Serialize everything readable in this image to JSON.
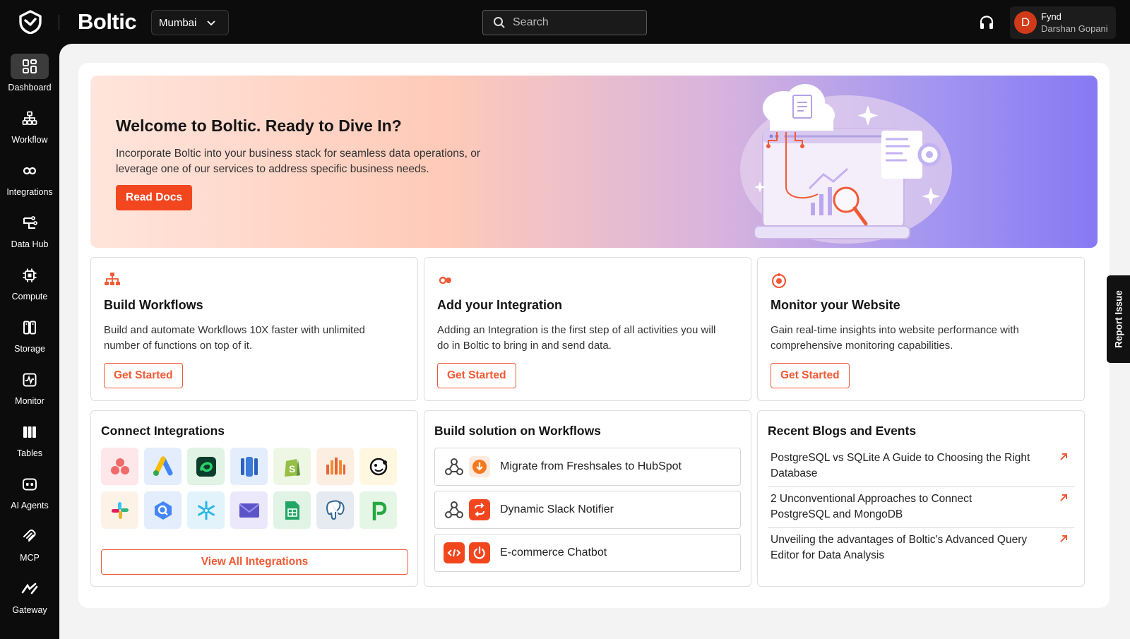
{
  "app": {
    "brand": "Boltic",
    "region": "Mumbai",
    "search_placeholder": "Search",
    "user_org": "Fynd",
    "user_name": "Darshan Gopani",
    "avatar_initial": "D",
    "report_issue": "Report Issue",
    "accent": "#f2461f"
  },
  "sidebar": {
    "items": [
      {
        "label": "Dashboard",
        "icon": "dashboard-icon",
        "active": true
      },
      {
        "label": "Workflow",
        "icon": "workflow-icon"
      },
      {
        "label": "Integrations",
        "icon": "integrations-icon"
      },
      {
        "label": "Data Hub",
        "icon": "data-hub-icon"
      },
      {
        "label": "Compute",
        "icon": "compute-icon"
      },
      {
        "label": "Storage",
        "icon": "storage-icon"
      },
      {
        "label": "Monitor",
        "icon": "monitor-icon"
      },
      {
        "label": "Tables",
        "icon": "tables-icon"
      },
      {
        "label": "AI Agents",
        "icon": "ai-agents-icon"
      },
      {
        "label": "MCP",
        "icon": "mcp-icon"
      },
      {
        "label": "Gateway",
        "icon": "gateway-icon"
      }
    ]
  },
  "hero": {
    "title": "Welcome to Boltic. Ready to Dive In?",
    "description": "Incorporate Boltic into your business stack for seamless data operations, or leverage one of our services to address specific business needs.",
    "button": "Read Docs"
  },
  "cards": [
    {
      "title": "Build Workflows",
      "description": "Build and automate Workflows 10X faster with unlimited number of functions on top of it.",
      "button": "Get Started",
      "icon": "workflow-icon"
    },
    {
      "title": "Add your Integration",
      "description": "Adding an Integration is the first step of all activities you will do in Boltic to bring in and send data.",
      "button": "Get Started",
      "icon": "integration-icon"
    },
    {
      "title": "Monitor your Website",
      "description": "Gain real-time insights into website performance with comprehensive monitoring capabilities.",
      "button": "Get Started",
      "icon": "monitor-icon"
    }
  ],
  "integrations": {
    "title": "Connect Integrations",
    "button": "View All Integrations",
    "icons": [
      "asana-icon",
      "google-ads-icon",
      "zoho-icon",
      "azure-db-icon",
      "shopify-icon",
      "aws-redshift-icon",
      "mailchimp-icon",
      "slack-icon",
      "bigquery-icon",
      "snowflake-icon",
      "email-icon",
      "google-sheets-icon",
      "postgresql-icon",
      "pipedrive-icon"
    ]
  },
  "workflows": {
    "title": "Build solution on Workflows",
    "items": [
      {
        "label": "Migrate from Freshsales to HubSpot"
      },
      {
        "label": "Dynamic Slack Notifier"
      },
      {
        "label": "E-commerce Chatbot"
      }
    ]
  },
  "blogs": {
    "title": "Recent Blogs and Events",
    "items": [
      {
        "title": "PostgreSQL vs SQLite A Guide to Choosing the Right Database"
      },
      {
        "title": "2 Unconventional Approaches to Connect PostgreSQL and MongoDB"
      },
      {
        "title": "Unveiling the advantages of Boltic's Advanced Query Editor for Data Analysis"
      }
    ]
  }
}
